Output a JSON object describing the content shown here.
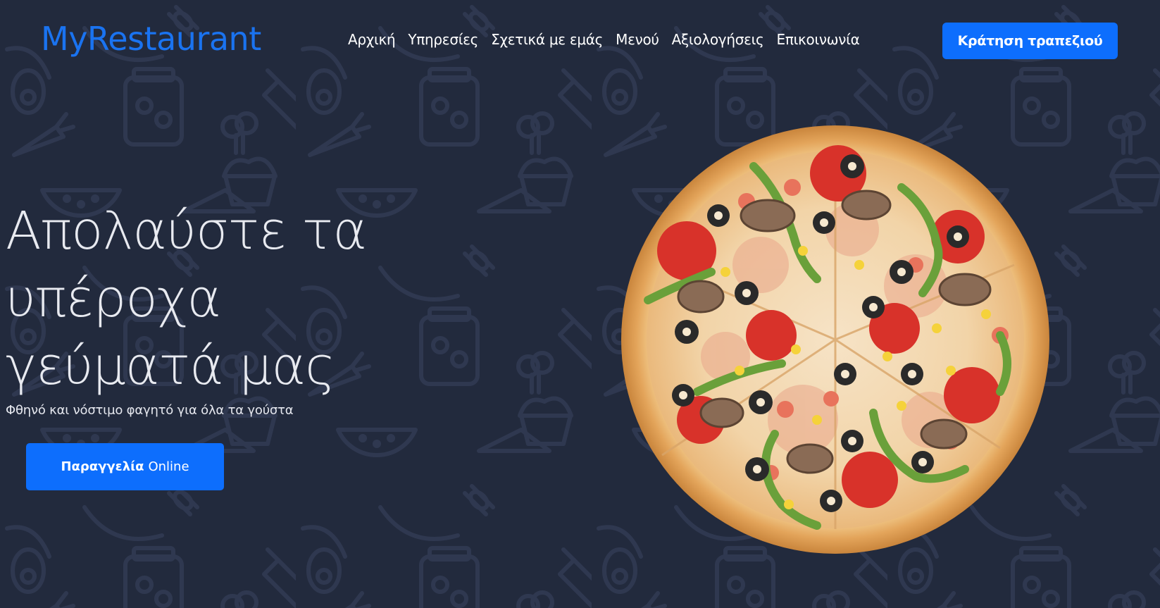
{
  "brand": "MyRestaurant",
  "nav": {
    "links": [
      "Αρχική",
      "Υπηρεσίες",
      "Σχετικά με εμάς",
      "Μενού",
      "Αξιολογήσεις",
      "Επικοινωνία"
    ],
    "reserve_label": "Κράτηση τραπεζιού"
  },
  "hero": {
    "title_lines": [
      "Απολαύστε τα",
      "υπέροχα",
      "γεύματά μας"
    ],
    "subtitle": "Φθηνό και νόστιμο φαγητό για όλα τα γούστα",
    "order_bold": "Παραγγελία",
    "order_rest": "Online"
  },
  "colors": {
    "background": "#222a3d",
    "accent": "#0d6efd",
    "brand": "#1a73f0"
  },
  "icons": [
    "pizza-image",
    "food-doodle-pattern"
  ]
}
